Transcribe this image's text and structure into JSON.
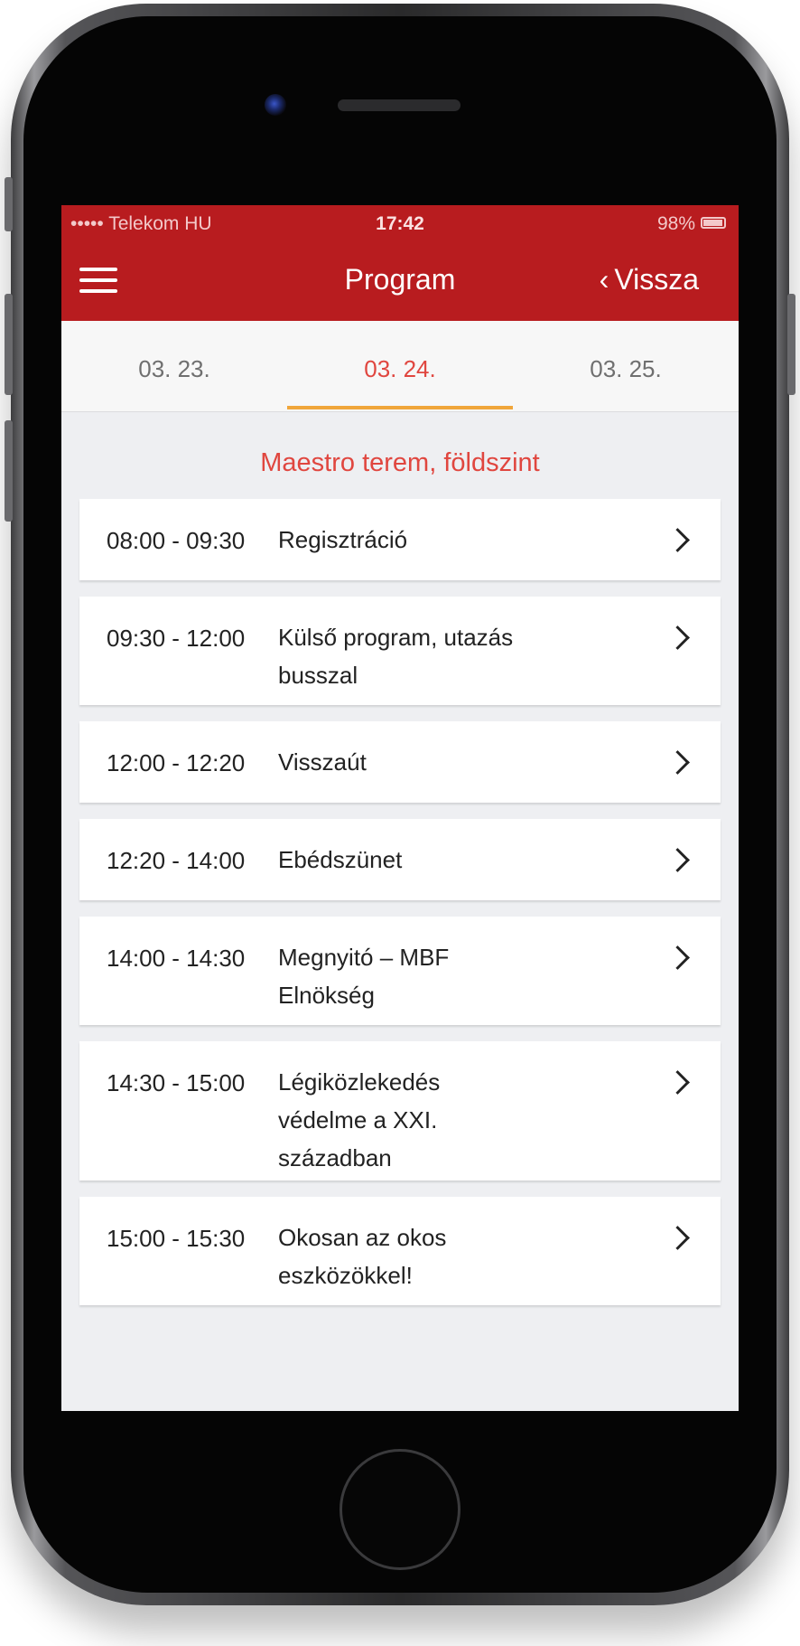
{
  "status_bar": {
    "carrier": "••••• Telekom HU",
    "time": "17:42",
    "battery": "98%"
  },
  "nav": {
    "title": "Program",
    "back_label": "Vissza",
    "menu_icon": "hamburger-menu-icon"
  },
  "tabs": [
    {
      "label": "03. 23.",
      "active": false
    },
    {
      "label": "03. 24.",
      "active": true
    },
    {
      "label": "03. 25.",
      "active": false
    }
  ],
  "section": {
    "title": "Maestro terem, földszint"
  },
  "sessions": [
    {
      "time": "08:00 - 09:30",
      "title": "Regisztráció"
    },
    {
      "time": "09:30 - 12:00",
      "title": "Külső program, utazás busszal"
    },
    {
      "time": "12:00 - 12:20",
      "title": "Visszaút"
    },
    {
      "time": "12:20 - 14:00",
      "title": "Ebédszünet"
    },
    {
      "time": "14:00 - 14:30",
      "title": "Megnyitó – MBF Elnökség"
    },
    {
      "time": "14:30 - 15:00",
      "title": "Légiközlekedés védelme a XXI. században"
    },
    {
      "time": "15:00 - 15:30",
      "title": "Okosan az okos eszközökkel!"
    }
  ],
  "colors": {
    "brand_red": "#b81c1f",
    "accent_red": "#e0463f",
    "tab_indicator": "#f0a63b"
  }
}
